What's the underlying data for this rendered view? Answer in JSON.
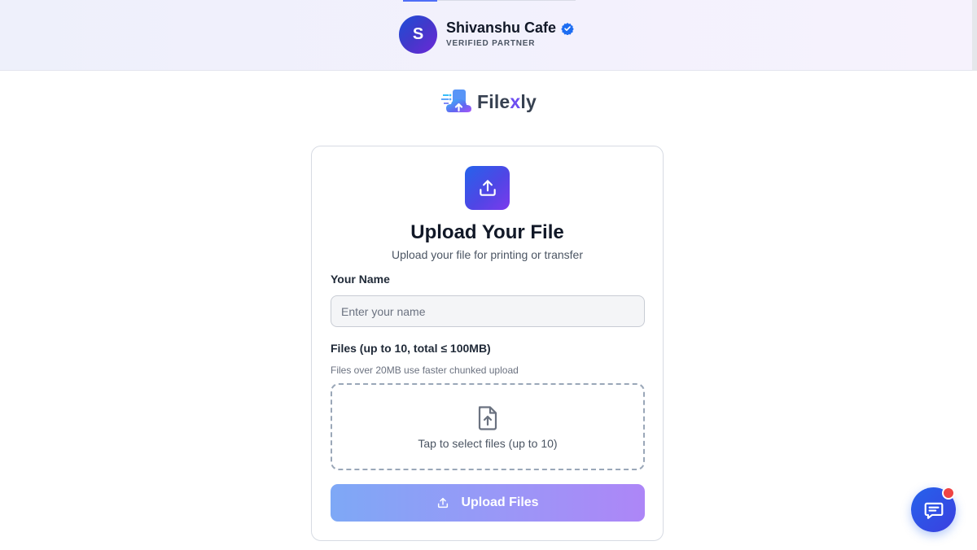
{
  "partner": {
    "avatar_initial": "S",
    "name": "Shivanshu Cafe",
    "badge": "VERIFIED PARTNER"
  },
  "logo": {
    "text_start": "File",
    "text_accent": "x",
    "text_end": "ly"
  },
  "card": {
    "title": "Upload Your File",
    "subtitle": "Upload your file for printing or transfer",
    "name_label": "Your Name",
    "name_placeholder": "Enter your name",
    "name_value": "",
    "files_label": "Files (up to 10, total ≤ 100MB)",
    "files_hint": "Files over 20MB use faster chunked upload",
    "dropzone_text": "Tap to select files (up to 10)",
    "upload_button": "Upload Files"
  },
  "colors": {
    "accent_blue": "#2563eb",
    "accent_purple": "#7c3aed",
    "notification": "#ef4444"
  },
  "icons": {
    "verified": "verified-check-icon",
    "upload": "upload-icon",
    "file_upload": "file-upload-icon",
    "chat": "chat-icon"
  }
}
